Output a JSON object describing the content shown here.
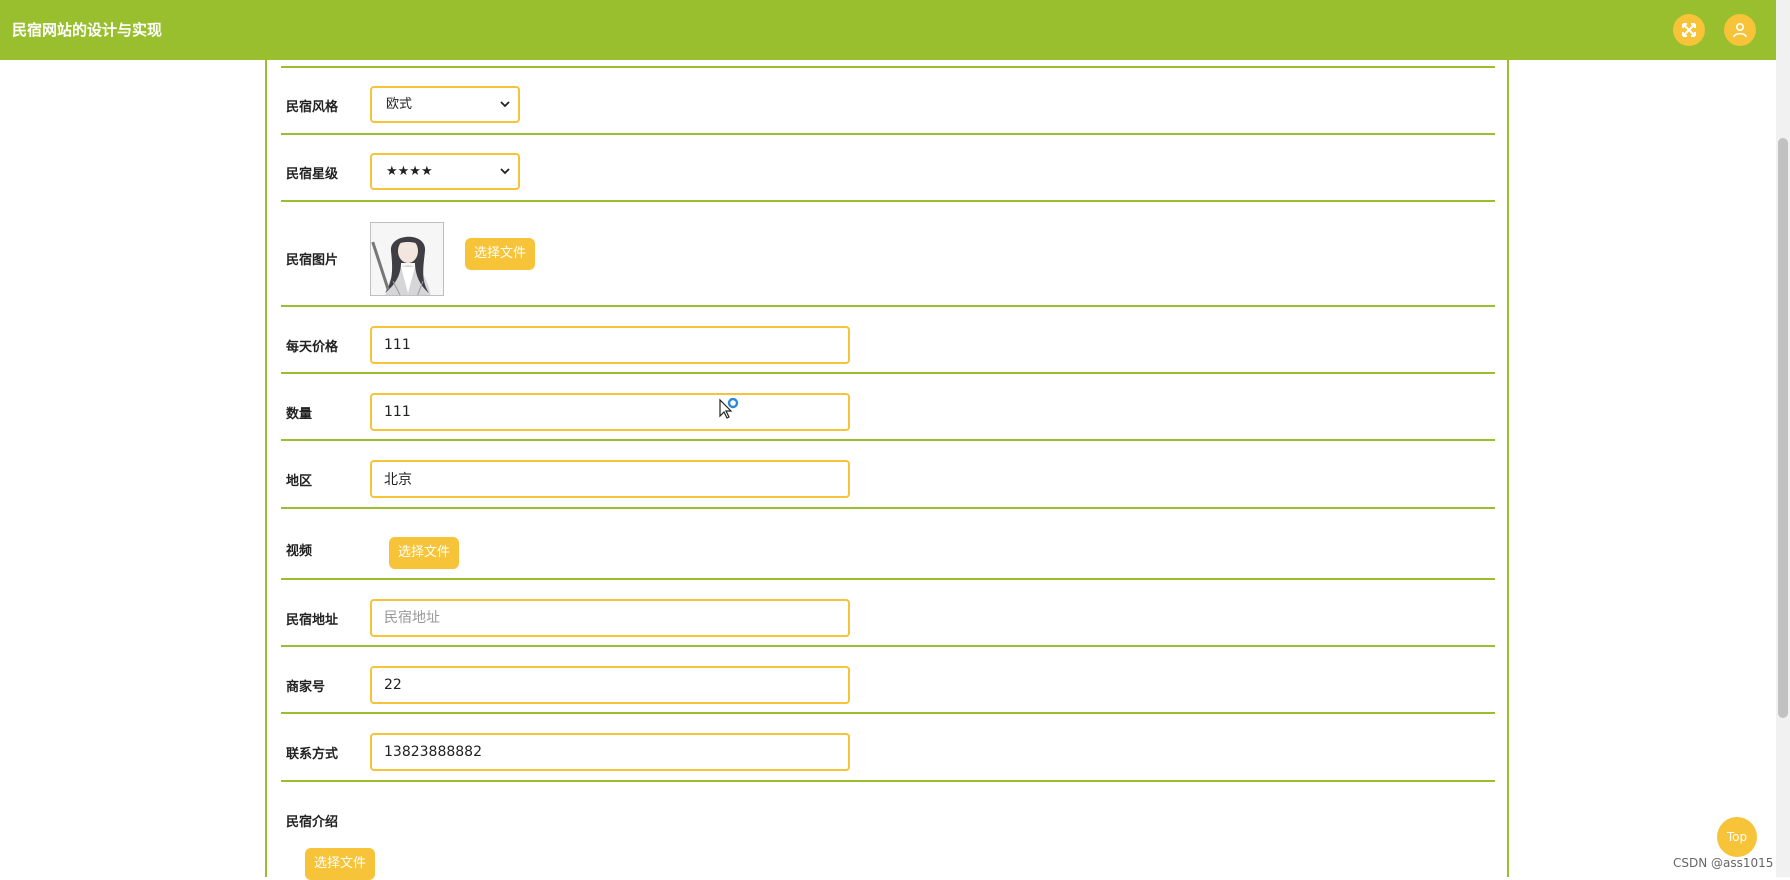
{
  "app": {
    "title": "民宿网站的设计与实现"
  },
  "header": {
    "fullscreen_icon": "fullscreen-icon",
    "user_icon": "user-icon"
  },
  "form": {
    "style": {
      "label": "民宿风格",
      "value": "欧式"
    },
    "stars": {
      "label": "民宿星级",
      "value": "★★★★"
    },
    "image": {
      "label": "民宿图片",
      "button": "选择文件"
    },
    "price": {
      "label": "每天价格",
      "value": "111"
    },
    "quantity": {
      "label": "数量",
      "value": "111"
    },
    "region": {
      "label": "地区",
      "value": "北京"
    },
    "video": {
      "label": "视频",
      "button": "选择文件"
    },
    "address": {
      "label": "民宿地址",
      "placeholder": "民宿地址"
    },
    "merchant": {
      "label": "商家号",
      "value": "22"
    },
    "contact": {
      "label": "联系方式",
      "value": "13823888882"
    },
    "intro": {
      "label": "民宿介绍",
      "button": "选择文件"
    }
  },
  "top_button": "Top",
  "watermark": "CSDN @ass1015",
  "colors": {
    "header": "#99bf2e",
    "accent": "#f6c339",
    "divider": "#99bf2e"
  }
}
